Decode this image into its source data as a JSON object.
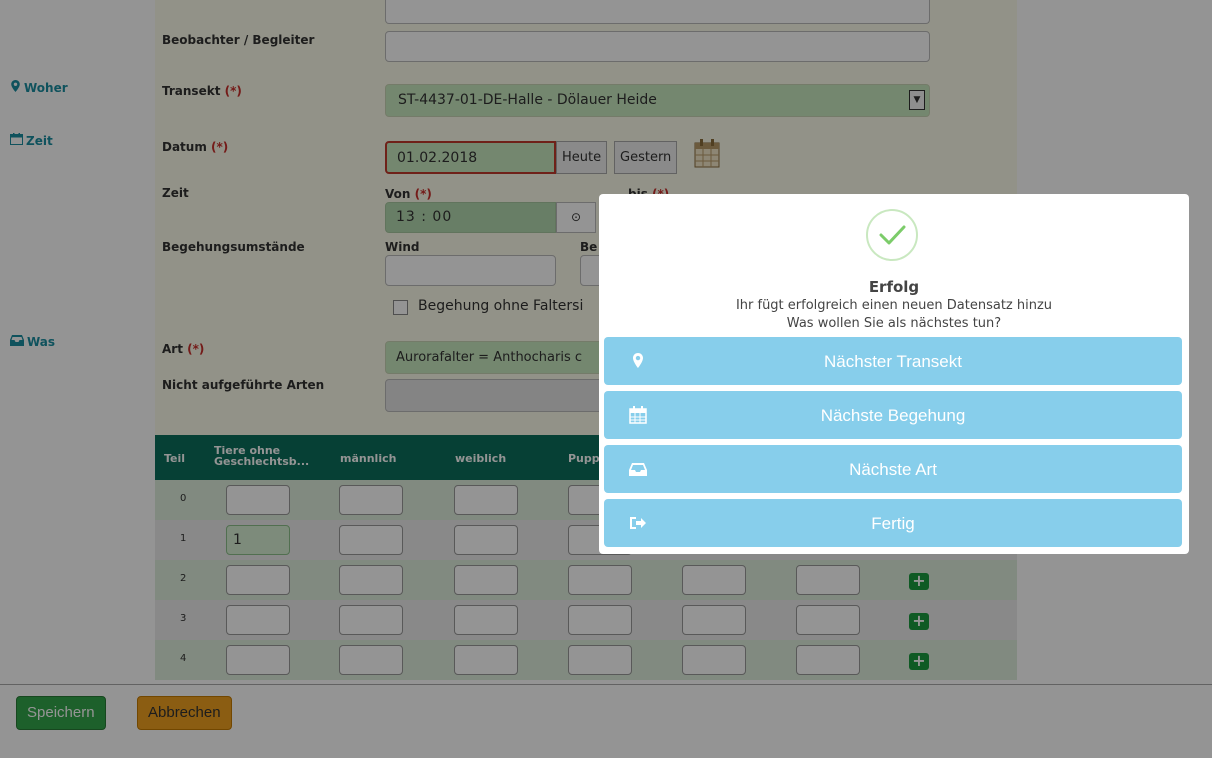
{
  "sidebar": {
    "woher": "Woher",
    "zeit": "Zeit",
    "was": "Was"
  },
  "form": {
    "observer_label": "Beobachter / Begleiter",
    "transect_label": "Transekt",
    "required_mark": "(*)",
    "transect_value": "ST-4437-01-DE-Halle - Dölauer Heide",
    "date_label": "Datum",
    "date_value": "01.02.2018",
    "today_button": "Heute",
    "yesterday_button": "Gestern",
    "time_label": "Zeit",
    "from_label": "Von",
    "to_label": "bis",
    "time_from_value": "13 : 00",
    "conditions_label": "Begehungsumstände",
    "wind_label": "Wind",
    "be_label": "Be",
    "no_butterflies_label": "Begehung ohne Faltersi",
    "species_label": "Art",
    "species_value": "Aurorafalter = Anthocharis c",
    "unlisted_label": "Nicht aufgeführte Arten"
  },
  "table": {
    "headers": {
      "part": "Teil",
      "no_sex_line1": "Tiere ohne",
      "no_sex_line2": "Geschlechtsb...",
      "male": "männlich",
      "female": "weiblich",
      "pupa": "Pupp"
    },
    "rows": [
      {
        "num": "0",
        "first_value": ""
      },
      {
        "num": "1",
        "first_value": "1"
      },
      {
        "num": "2",
        "first_value": ""
      },
      {
        "num": "3",
        "first_value": ""
      },
      {
        "num": "4",
        "first_value": ""
      }
    ]
  },
  "footer": {
    "save_button": "Speichern",
    "cancel_button": "Abbrechen"
  },
  "modal": {
    "title": "Erfolg",
    "message_line1": "Ihr fügt erfolgreich einen neuen Datensatz hinzu",
    "message_line2": "Was wollen Sie als nächstes tun?",
    "actions": [
      {
        "label": "Nächster Transekt",
        "icon": "map-marker-icon"
      },
      {
        "label": "Nächste Begehung",
        "icon": "calendar-icon"
      },
      {
        "label": "Nächste Art",
        "icon": "inbox-icon"
      },
      {
        "label": "Fertig",
        "icon": "sign-out-icon"
      }
    ]
  },
  "colors": {
    "accent_teal": "#1b8ea0",
    "table_header": "#0b6f5c",
    "modal_button": "#87ceeb",
    "save_green": "#33a64a",
    "cancel_orange": "#f0a020"
  }
}
